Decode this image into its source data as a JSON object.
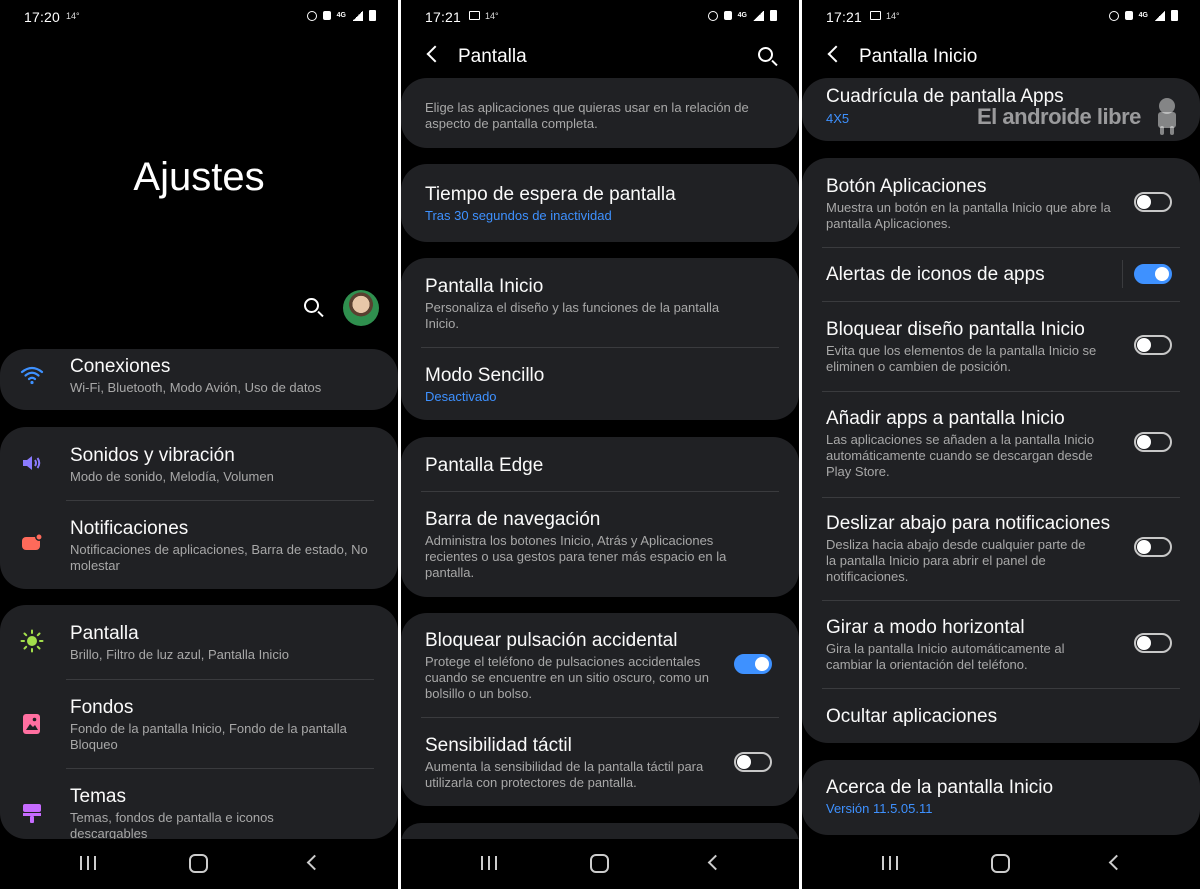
{
  "left": {
    "time": "17:20",
    "temp": "14°",
    "big_title": "Ajustes",
    "items": [
      {
        "title": "Conexiones",
        "sub": "Wi-Fi, Bluetooth, Modo Avión, Uso de datos"
      },
      {
        "title": "Sonidos y vibración",
        "sub": "Modo de sonido, Melodía, Volumen"
      },
      {
        "title": "Notificaciones",
        "sub": "Notificaciones de aplicaciones, Barra de estado, No molestar"
      },
      {
        "title": "Pantalla",
        "sub": "Brillo, Filtro de luz azul, Pantalla Inicio"
      },
      {
        "title": "Fondos",
        "sub": "Fondo de la pantalla Inicio, Fondo de la pantalla Bloqueo"
      },
      {
        "title": "Temas",
        "sub": "Temas, fondos de pantalla e iconos descargables"
      }
    ],
    "colors": {
      "wifi": "#3e91ff",
      "sound": "#8b7bff",
      "notif": "#ff6a5a",
      "display": "#a4e04c",
      "wallpaper": "#ff6fa0",
      "themes": "#c66bff"
    }
  },
  "middle": {
    "time": "17:21",
    "temp": "14°",
    "header_title": "Pantalla",
    "items": [
      {
        "title": "",
        "sub": "Elige las aplicaciones que quieras usar en la relación de aspecto de pantalla completa."
      },
      {
        "title": "Tiempo de espera de pantalla",
        "sub": "Tras 30 segundos de inactividad"
      },
      {
        "title": "Pantalla Inicio",
        "sub": "Personaliza el diseño y las funciones de la pantalla Inicio."
      },
      {
        "title": "Modo Sencillo",
        "sub": "Desactivado"
      },
      {
        "title": "Pantalla Edge",
        "sub": ""
      },
      {
        "title": "Barra de navegación",
        "sub": "Administra los botones Inicio, Atrás y Aplicaciones recientes o usa gestos para tener más espacio en la pantalla."
      },
      {
        "title": "Bloquear pulsación accidental",
        "sub": "Protege el teléfono de pulsaciones accidentales cuando se encuentre en un sitio oscuro, como un bolsillo o un bolso."
      },
      {
        "title": "Sensibilidad táctil",
        "sub": "Aumenta la sensibilidad de la pantalla táctil para utilizarla con protectores de pantalla."
      }
    ]
  },
  "right": {
    "time": "17:21",
    "temp": "14°",
    "header_title": "Pantalla Inicio",
    "watermark": "El androide libre",
    "items": [
      {
        "title": "Cuadrícula de pantalla Apps",
        "sub": "4X5"
      },
      {
        "title": "Botón Aplicaciones",
        "sub": "Muestra un botón en la pantalla Inicio que abre la pantalla Aplicaciones."
      },
      {
        "title": "Alertas de iconos de apps",
        "sub": ""
      },
      {
        "title": "Bloquear diseño pantalla Inicio",
        "sub": "Evita que los elementos de la pantalla Inicio se eliminen o cambien de posición."
      },
      {
        "title": "Añadir apps a pantalla Inicio",
        "sub": "Las aplicaciones se añaden a la pantalla Inicio automáticamente cuando se descargan desde Play Store."
      },
      {
        "title": "Deslizar abajo para notificaciones",
        "sub": "Desliza hacia abajo desde cualquier parte de la pantalla Inicio para abrir el panel de notificaciones."
      },
      {
        "title": "Girar a modo horizontal",
        "sub": "Gira la pantalla Inicio automáticamente al cambiar la orientación del teléfono."
      },
      {
        "title": "Ocultar aplicaciones",
        "sub": ""
      },
      {
        "title": "Acerca de la pantalla Inicio",
        "sub": "Versión 11.5.05.11"
      }
    ]
  },
  "toggles": {
    "bloquear_pulsacion": "on",
    "sensibilidad_tactil": "off",
    "boton_aplicaciones": "off",
    "alertas_iconos": "on",
    "bloquear_diseno": "off",
    "anadir_apps": "off",
    "deslizar_abajo": "off",
    "girar_horizontal": "off"
  }
}
